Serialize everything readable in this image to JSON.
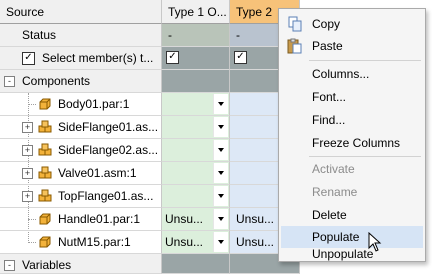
{
  "headers": {
    "source": "Source",
    "type1": "Type 1 O...",
    "type2": "Type 2"
  },
  "colors": {
    "type1_bg": "#dcefdc",
    "type2_bg": "#dde8f6",
    "type2_header": "#f7c279",
    "selected_row": "#9aa5a6",
    "menu_highlight": "#d6e4f5"
  },
  "rows": {
    "status": {
      "label": "Status",
      "type1": "-",
      "type2": "-"
    },
    "select_members": {
      "label": "Select member(s) t...",
      "checked": true,
      "type1_checked": true,
      "type2_checked": true
    },
    "components": {
      "label": "Components",
      "expander": "-"
    },
    "body01": {
      "label": "Body01.par:1",
      "icon": "part-icon"
    },
    "sideflange01": {
      "label": "SideFlange01.as...",
      "icon": "assembly-icon",
      "expander": "+"
    },
    "sideflange02": {
      "label": "SideFlange02.as...",
      "icon": "assembly-icon",
      "expander": "+"
    },
    "valve01": {
      "label": "Valve01.asm:1",
      "icon": "assembly-icon",
      "expander": "+"
    },
    "topflange01": {
      "label": "TopFlange01.as...",
      "icon": "assembly-icon",
      "expander": "+"
    },
    "handle01": {
      "label": "Handle01.par:1",
      "icon": "part-icon",
      "type1": "Unsu...",
      "type2": "Unsu..."
    },
    "nutm15": {
      "label": "NutM15.par:1",
      "icon": "part-icon",
      "type1": "Unsu...",
      "type2": "Unsu..."
    },
    "variables": {
      "label": "Variables",
      "expander": "-"
    }
  },
  "context_menu": {
    "items": [
      {
        "label": "Copy",
        "icon": "copy-icon",
        "enabled": true
      },
      {
        "label": "Paste",
        "icon": "paste-icon",
        "enabled": true
      },
      {
        "label": "Columns...",
        "enabled": true
      },
      {
        "label": "Font...",
        "enabled": true
      },
      {
        "label": "Find...",
        "enabled": true
      },
      {
        "label": "Freeze Columns",
        "enabled": true
      },
      {
        "label": "Activate",
        "enabled": false
      },
      {
        "label": "Rename",
        "enabled": false
      },
      {
        "label": "Delete",
        "enabled": true
      },
      {
        "label": "Populate",
        "enabled": true,
        "highlighted": true
      },
      {
        "label": "Unpopulate",
        "enabled": true
      }
    ]
  }
}
